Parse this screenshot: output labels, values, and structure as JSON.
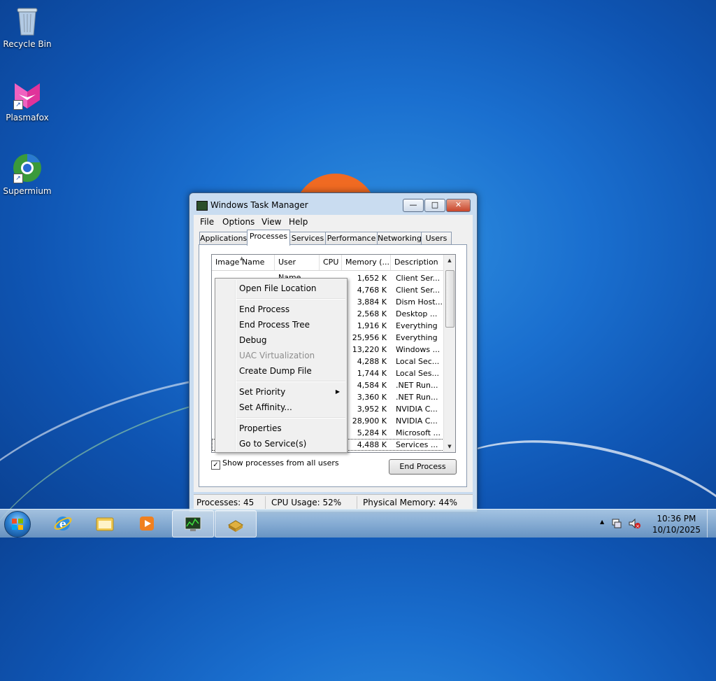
{
  "desktop": {
    "icons": [
      {
        "label": "Recycle Bin",
        "icon": "recycle-bin-icon"
      },
      {
        "label": "Plasmafox",
        "icon": "plasmafox-icon"
      },
      {
        "label": "Supermium",
        "icon": "supermium-icon"
      }
    ]
  },
  "window": {
    "title": "Windows Task Manager",
    "controls": {
      "minimize": "—",
      "maximize": "□",
      "close": "✕"
    },
    "menu": [
      "File",
      "Options",
      "View",
      "Help"
    ],
    "tabs": [
      "Applications",
      "Processes",
      "Services",
      "Performance",
      "Networking",
      "Users"
    ],
    "active_tab": "Processes",
    "columns": [
      "Image Name",
      "User Name",
      "CPU",
      "Memory (...",
      "Description"
    ],
    "rows": [
      {
        "memory": "1,652 K",
        "description": "Client Ser..."
      },
      {
        "memory": "4,768 K",
        "description": "Client Ser..."
      },
      {
        "memory": "3,884 K",
        "description": "Dism Host..."
      },
      {
        "memory": "2,568 K",
        "description": "Desktop ..."
      },
      {
        "memory": "1,916 K",
        "description": "Everything"
      },
      {
        "memory": "25,956 K",
        "description": "Everything"
      },
      {
        "memory": "13,220 K",
        "description": "Windows ..."
      },
      {
        "memory": "4,288 K",
        "description": "Local Sec..."
      },
      {
        "memory": "1,744 K",
        "description": "Local Ses..."
      },
      {
        "memory": "4,584 K",
        "description": ".NET Run..."
      },
      {
        "memory": "3,360 K",
        "description": ".NET Run..."
      },
      {
        "memory": "3,952 K",
        "description": "NVIDIA C..."
      },
      {
        "memory": "28,900 K",
        "description": "NVIDIA C..."
      },
      {
        "memory": "5,284 K",
        "description": "Microsoft ..."
      },
      {
        "memory": "4,488 K",
        "description": "Services ..."
      }
    ],
    "show_all_users": {
      "label": "Show processes from all users",
      "checked": true,
      "mark": "✓"
    },
    "end_process_button": "End Process",
    "status": {
      "processes": "Processes: 45",
      "cpu": "CPU Usage: 52%",
      "memory": "Physical Memory: 44%"
    }
  },
  "context_menu": {
    "items": [
      {
        "label": "Open File Location",
        "enabled": true
      },
      {
        "label": "End Process",
        "enabled": true
      },
      {
        "label": "End Process Tree",
        "enabled": true
      },
      {
        "label": "Debug",
        "enabled": true
      },
      {
        "label": "UAC Virtualization",
        "enabled": false
      },
      {
        "label": "Create Dump File",
        "enabled": true
      },
      {
        "label": "Set Priority",
        "enabled": true,
        "submenu": true
      },
      {
        "label": "Set Affinity...",
        "enabled": true
      },
      {
        "label": "Properties",
        "enabled": true
      },
      {
        "label": "Go to Service(s)",
        "enabled": true
      }
    ],
    "submenu_arrow": "▶"
  },
  "taskbar": {
    "pinned": [
      {
        "name": "internet-explorer-icon"
      },
      {
        "name": "windows-explorer-icon"
      },
      {
        "name": "media-player-icon"
      },
      {
        "name": "task-manager-icon",
        "active": true
      },
      {
        "name": "app-icon",
        "active": true
      }
    ],
    "tray": {
      "chevron": "▲"
    },
    "clock": {
      "time": "10:36 PM",
      "date": "10/10/2025"
    }
  },
  "colors": {
    "accent": "#1a6fcf",
    "close": "#c8452a"
  }
}
